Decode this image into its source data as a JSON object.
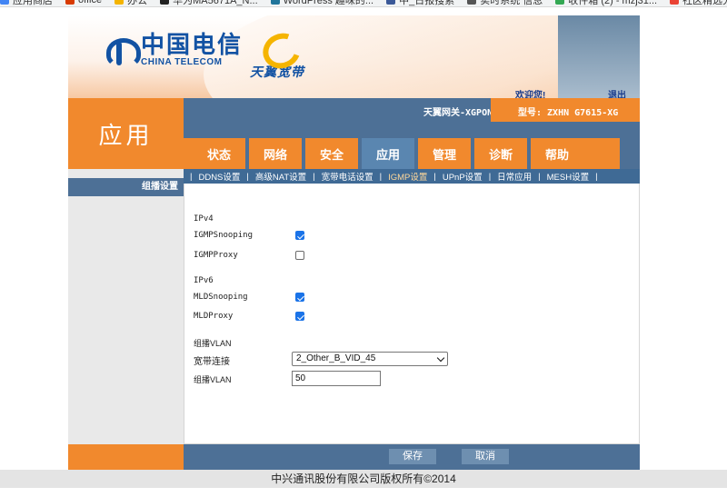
{
  "bookmarks": [
    {
      "label": "应用商店",
      "color": "#4285f4"
    },
    {
      "label": "office",
      "color": "#d83b01"
    },
    {
      "label": "办公",
      "color": "#f4b400"
    },
    {
      "label": "华为MA5671A_N...",
      "color": "#222222"
    },
    {
      "label": "WordPress 趣味的...",
      "color": "#21759b"
    },
    {
      "label": "中_日报搜索",
      "color": "#3b5998"
    },
    {
      "label": "实时系统 信息",
      "color": "#555555"
    },
    {
      "label": "收件箱 (2) - mzj31...",
      "color": "#34a853"
    },
    {
      "label": "社区精选分享",
      "color": "#ea4335"
    }
  ],
  "header": {
    "brand_cn": "中国电信",
    "brand_en": "CHINA TELECOM",
    "subbrand": "天翼宽带",
    "welcome": "欢迎您!",
    "logout": "退出"
  },
  "section_title": "应用",
  "infobar": {
    "gateway": "天翼网关-XGPON",
    "model": "型号: ZXHN G7615-XG"
  },
  "tabs": [
    "状态",
    "网络",
    "安全",
    "应用",
    "管理",
    "诊断",
    "帮助"
  ],
  "active_tab": "应用",
  "subnav": [
    "DDNS设置",
    "高级NAT设置",
    "宽带电话设置",
    "IGMP设置",
    "UPnP设置",
    "日常应用",
    "MESH设置"
  ],
  "active_sub": "IGMP设置",
  "sidebar": {
    "item": "组播设置"
  },
  "form": {
    "ipv4_label": "IPv4",
    "igmp_snooping_label": "IGMPSnooping",
    "igmp_snooping_checked": true,
    "igmp_proxy_label": "IGMPProxy",
    "igmp_proxy_checked": false,
    "ipv6_label": "IPv6",
    "mld_snooping_label": "MLDSnooping",
    "mld_snooping_checked": true,
    "mld_proxy_label": "MLDProxy",
    "mld_proxy_checked": true,
    "vlan_section_label": "组播VLAN",
    "wan_label": "宽带连接",
    "wan_value": "2_Other_B_VID_45",
    "vlan_label": "组播VLAN",
    "vlan_value": "50"
  },
  "buttons": {
    "save": "保存",
    "cancel": "取消"
  },
  "footer": "中兴通讯股份有限公司版权所有©2014"
}
